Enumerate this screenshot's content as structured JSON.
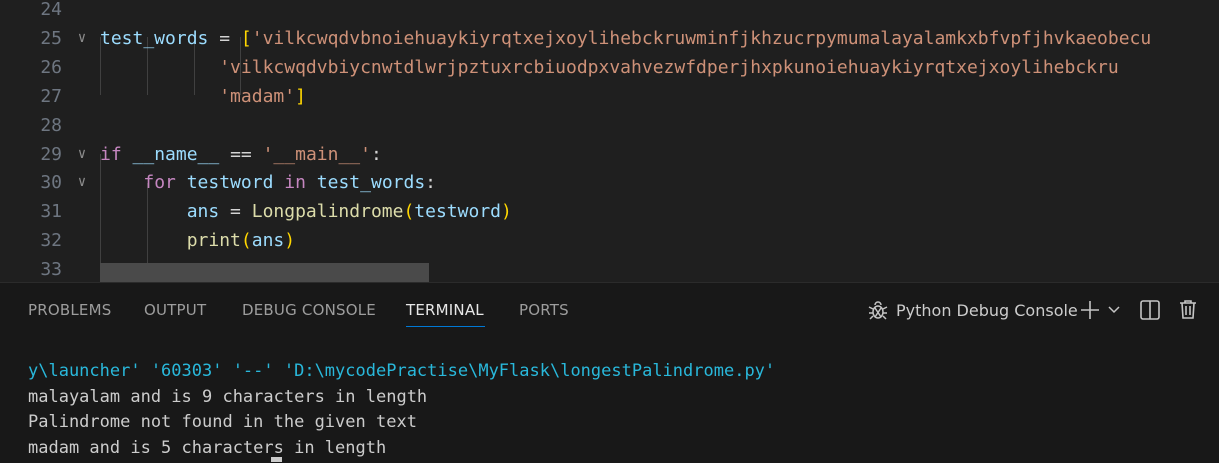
{
  "editor": {
    "lines": [
      {
        "number": "24",
        "parts": []
      },
      {
        "number": "25",
        "fold": true,
        "parts": [
          {
            "t": "test_words",
            "c": "var"
          },
          {
            "t": " = ",
            "c": "op"
          },
          {
            "t": "[",
            "c": "br1"
          },
          {
            "t": "'vilkcwqdvbnoiehuaykiyrqtxejxoylihebckruwminfjkhzucrpymumalayalamkxbfvpfjhvkaeobecu",
            "c": "str"
          }
        ]
      },
      {
        "number": "26",
        "parts": [
          {
            "t": "           ",
            "c": "op"
          },
          {
            "t": "'vilkcwqdvbiycnwtdlwrjpztuxrcbiuodpxvahvezwfdperjhxpkunoiehuaykiyrqtxejxoylihebckru",
            "c": "str"
          }
        ]
      },
      {
        "number": "27",
        "parts": [
          {
            "t": "           ",
            "c": "op"
          },
          {
            "t": "'madam'",
            "c": "str"
          },
          {
            "t": "]",
            "c": "br1"
          }
        ]
      },
      {
        "number": "28",
        "parts": []
      },
      {
        "number": "29",
        "fold": true,
        "parts": [
          {
            "t": "if",
            "c": "kw"
          },
          {
            "t": " ",
            "c": "op"
          },
          {
            "t": "__name__",
            "c": "var"
          },
          {
            "t": " == ",
            "c": "op"
          },
          {
            "t": "'__main__'",
            "c": "str"
          },
          {
            "t": ":",
            "c": "op"
          }
        ]
      },
      {
        "number": "30",
        "fold": true,
        "parts": [
          {
            "t": "    ",
            "c": "op"
          },
          {
            "t": "for",
            "c": "kw"
          },
          {
            "t": " ",
            "c": "op"
          },
          {
            "t": "testword",
            "c": "var"
          },
          {
            "t": " ",
            "c": "op"
          },
          {
            "t": "in",
            "c": "kw"
          },
          {
            "t": " ",
            "c": "op"
          },
          {
            "t": "test_words",
            "c": "var"
          },
          {
            "t": ":",
            "c": "op"
          }
        ]
      },
      {
        "number": "31",
        "parts": [
          {
            "t": "        ",
            "c": "op"
          },
          {
            "t": "ans",
            "c": "var"
          },
          {
            "t": " = ",
            "c": "op"
          },
          {
            "t": "Longpalindrome",
            "c": "fn"
          },
          {
            "t": "(",
            "c": "br1"
          },
          {
            "t": "testword",
            "c": "var"
          },
          {
            "t": ")",
            "c": "br1"
          }
        ]
      },
      {
        "number": "32",
        "parts": [
          {
            "t": "        ",
            "c": "op"
          },
          {
            "t": "print",
            "c": "fn"
          },
          {
            "t": "(",
            "c": "br1"
          },
          {
            "t": "ans",
            "c": "var"
          },
          {
            "t": ")",
            "c": "br1"
          }
        ]
      },
      {
        "number": "33",
        "parts": []
      }
    ]
  },
  "panel": {
    "tabs": [
      "PROBLEMS",
      "OUTPUT",
      "DEBUG CONSOLE",
      "TERMINAL",
      "PORTS"
    ],
    "active_tab": "TERMINAL",
    "debug_console_label": "Python Debug Console",
    "icons": {
      "debug": "bug-icon",
      "add": "plus-icon",
      "dropdown": "chevron-down-icon",
      "split": "split-terminal-icon",
      "trash": "trash-icon"
    }
  },
  "terminal": {
    "lines": [
      {
        "text": "y\\launcher' '60303' '--' 'D:\\mycodePractise\\MyFlask\\longestPalindrome.py'",
        "kind": "path"
      },
      {
        "text": "malayalam and is 9 characters in length",
        "kind": "out"
      },
      {
        "text": "Palindrome not found in the given text",
        "kind": "out"
      },
      {
        "text": "madam and is 5 characters in length",
        "kind": "out"
      }
    ]
  },
  "colors": {
    "accent": "#0078d4",
    "terminal_path": "#29b8db",
    "string": "#ce9178",
    "keyword": "#c586c0",
    "variable": "#9cdcfe",
    "function": "#dcdcaa"
  }
}
